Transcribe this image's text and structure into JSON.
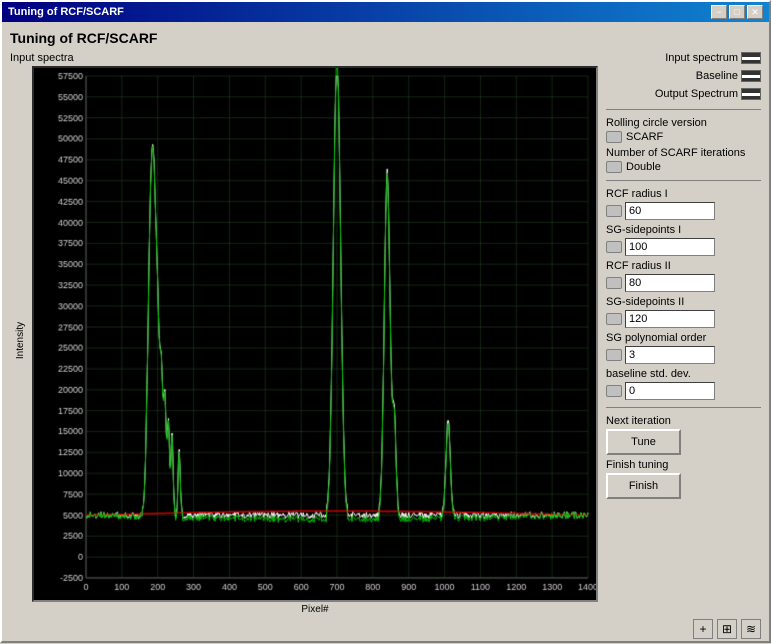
{
  "window": {
    "title": "Tuning of RCF/SCARF",
    "close_btn": "✕",
    "minimize_btn": "−",
    "maximize_btn": "□"
  },
  "page": {
    "title": "Tuning of RCF/SCARF",
    "chart_section_label": "Input spectra",
    "x_axis_label": "Pixel#",
    "y_axis_label": "Intensity"
  },
  "legend": {
    "input_spectrum": "Input spectrum",
    "baseline": "Baseline",
    "output_spectrum": "Output Spectrum"
  },
  "controls": {
    "rolling_circle_label": "Rolling circle version",
    "rolling_circle_value": "SCARF",
    "scarf_iterations_label": "Number of SCARF iterations",
    "scarf_iterations_value": "Double",
    "rcf_radius_i_label": "RCF radius I",
    "rcf_radius_i_value": "60",
    "sg_sidepoints_i_label": "SG-sidepoints I",
    "sg_sidepoints_i_value": "100",
    "rcf_radius_ii_label": "RCF radius II",
    "rcf_radius_ii_value": "80",
    "sg_sidepoints_ii_label": "SG-sidepoints II",
    "sg_sidepoints_ii_value": "120",
    "sg_poly_order_label": "SG polynomial order",
    "sg_poly_order_value": "3",
    "baseline_std_label": "baseline std. dev.",
    "baseline_std_value": "0",
    "next_iteration_label": "Next iteration",
    "tune_btn": "Tune",
    "finish_tuning_label": "Finish tuning",
    "finish_btn": "Finish"
  },
  "chart": {
    "y_ticks": [
      "57500",
      "55000",
      "52500",
      "50000",
      "47500",
      "45000",
      "42500",
      "40000",
      "37500",
      "35000",
      "32500",
      "30000",
      "27500",
      "25000",
      "22500",
      "20000",
      "17500",
      "15000",
      "12500",
      "10000",
      "7500",
      "5000",
      "2500",
      "0",
      "-2500"
    ],
    "x_ticks": [
      "0",
      "100",
      "200",
      "300",
      "400",
      "500",
      "600",
      "700",
      "800",
      "900",
      "1000",
      "1100",
      "1200",
      "1300",
      "1400"
    ]
  }
}
